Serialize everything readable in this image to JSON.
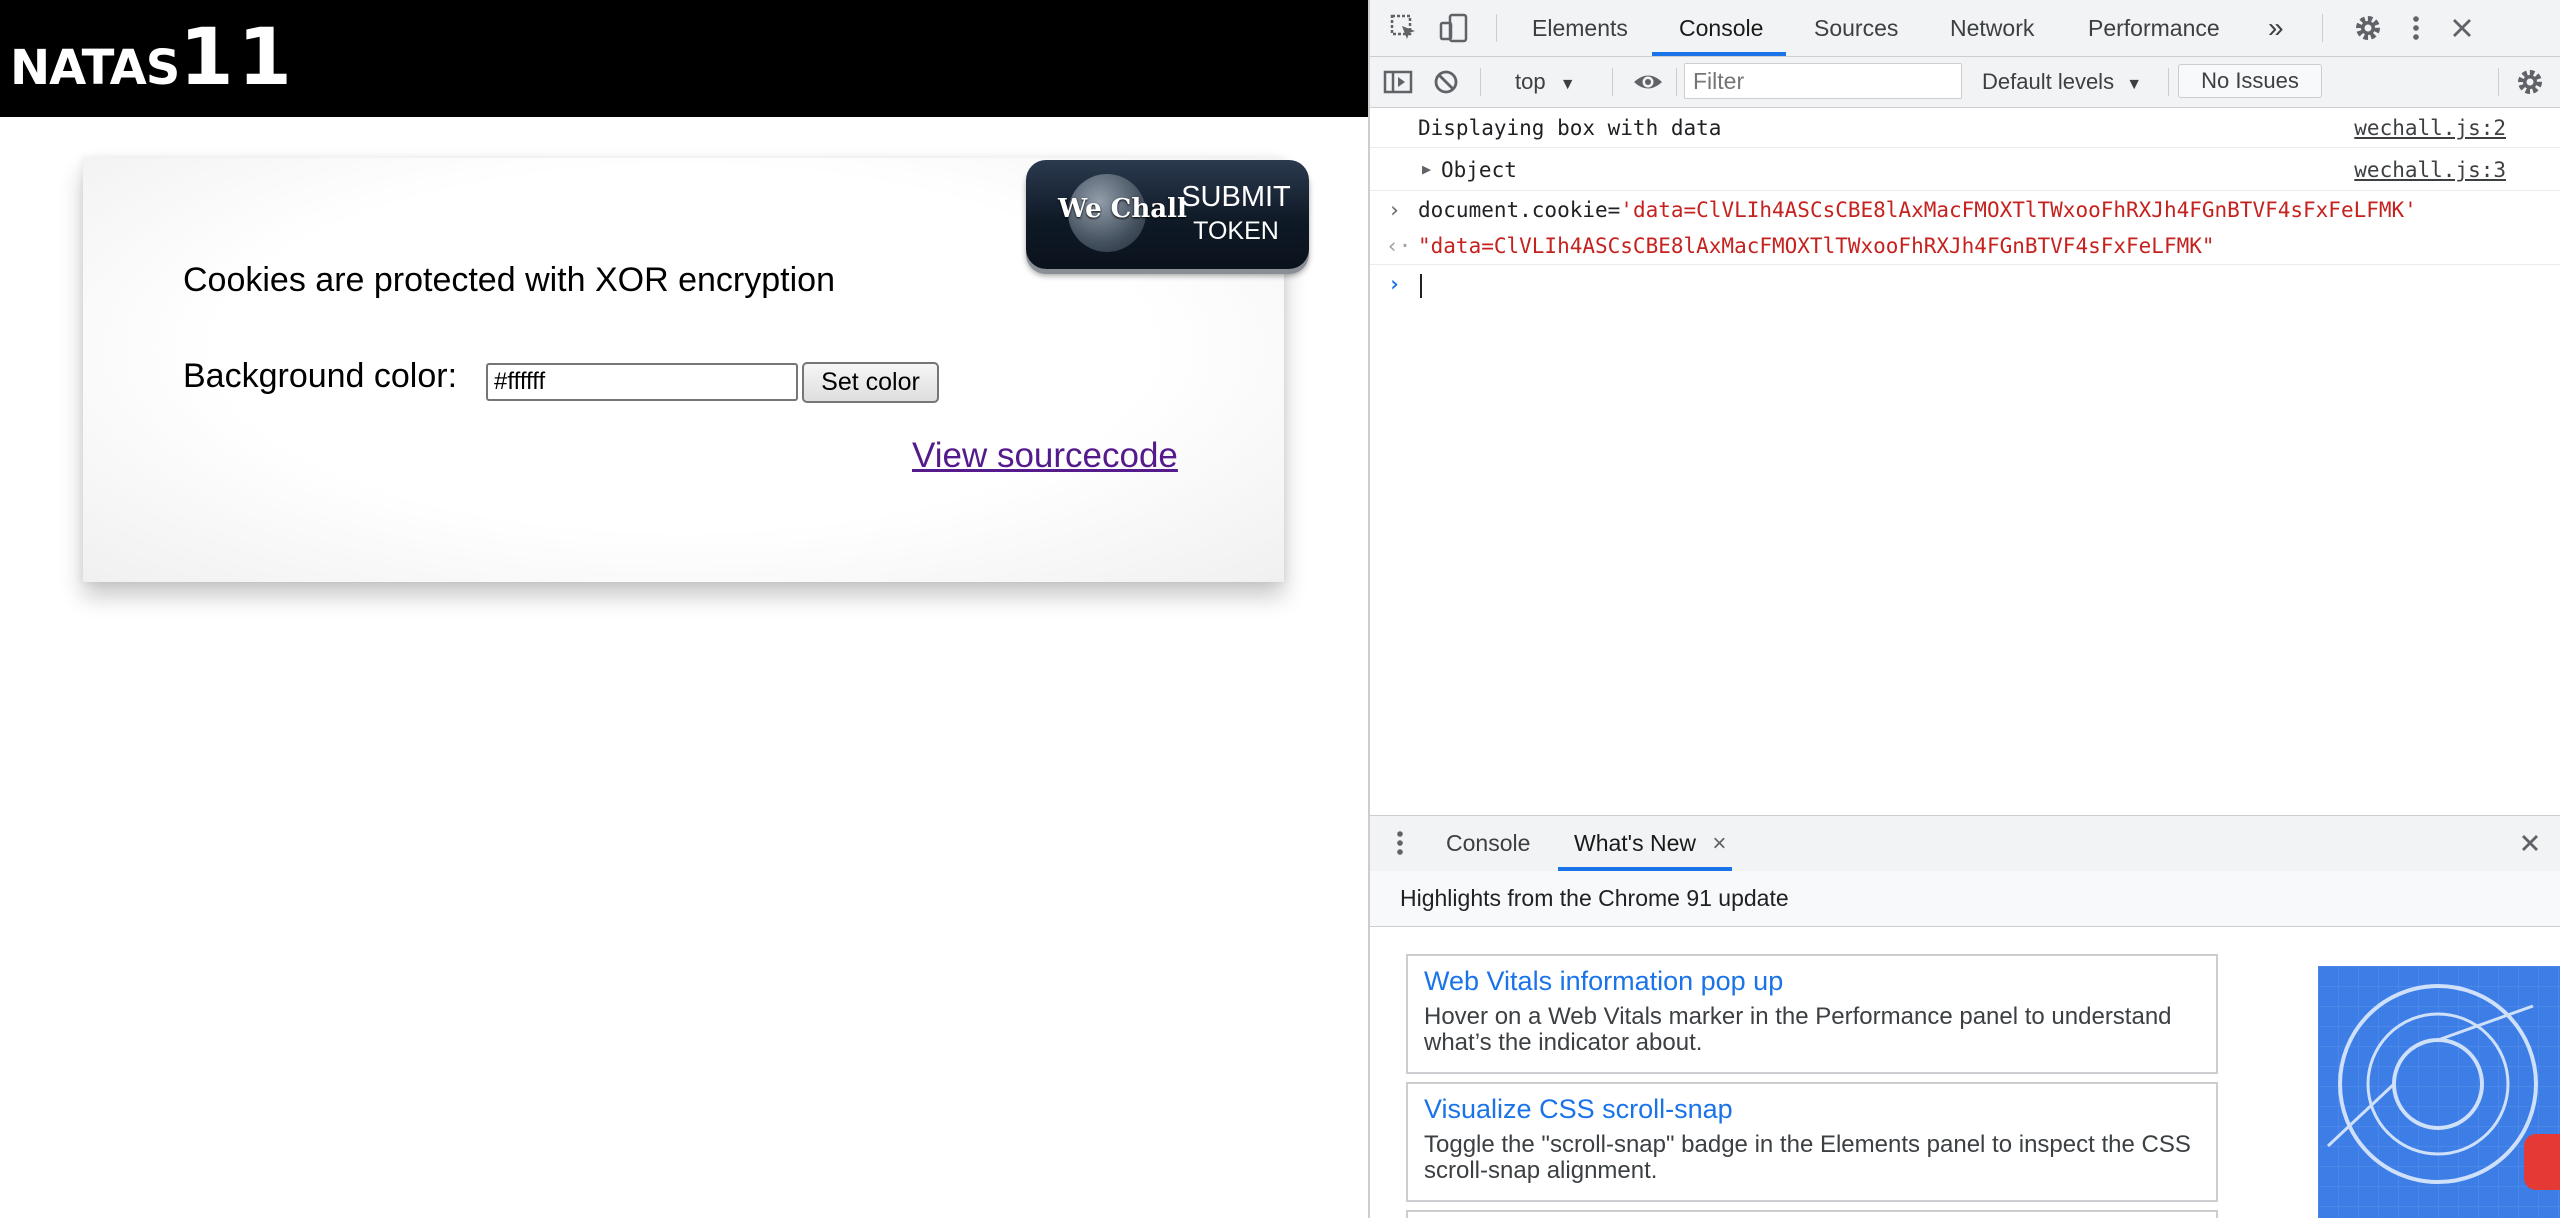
{
  "page": {
    "title_part1": "NATAS",
    "title_part2": "11",
    "wechall": {
      "logo_text": "We Chall",
      "submit_line1": "SUBMIT",
      "submit_line2": "TOKEN"
    },
    "xor_text": "Cookies are protected with XOR encryption",
    "bg_color_label": "Background color:",
    "bg_color_value": "#ffffff",
    "set_color_label": "Set color",
    "view_source_label": "View sourcecode"
  },
  "devtools": {
    "tabs": [
      "Elements",
      "Console",
      "Sources",
      "Network",
      "Performance"
    ],
    "active_tab": "Console",
    "more_tabs_glyph": "»",
    "toolbar": {
      "context": "top",
      "filter_placeholder": "Filter",
      "levels": "Default levels",
      "issues": "No Issues"
    },
    "console": {
      "line1_text": "Displaying box with data",
      "line1_src": "wechall.js:2",
      "line2_text": "Object",
      "line2_src": "wechall.js:3",
      "cmd_prefix": "document.cookie=",
      "cmd_value": "'data=ClVLIh4ASCsCBE8lAxMacFMOXTlTWxooFhRXJh4FGnBTVF4sFxFeLFMK'",
      "result": "\"data=ClVLIh4ASCsCBE8lAxMacFMOXTlTWxooFhRXJh4FGnBTVF4sFxFeLFMK\""
    },
    "drawer": {
      "tabs": [
        "Console",
        "What's New"
      ],
      "active_tab": "What's New",
      "highlights": "Highlights from the Chrome 91 update",
      "cards": [
        {
          "title": "Web Vitals information pop up",
          "desc": "Hover on a Web Vitals marker in the Performance panel to understand what’s the indicator about."
        },
        {
          "title": "Visualize CSS scroll-snap",
          "desc": "Toggle the \"scroll-snap\" badge in the Elements panel to inspect the CSS scroll-snap alignment."
        }
      ]
    },
    "colors": {
      "accent": "#1a73e8",
      "string": "#c5221f",
      "link_visited": "#551a8b"
    }
  }
}
